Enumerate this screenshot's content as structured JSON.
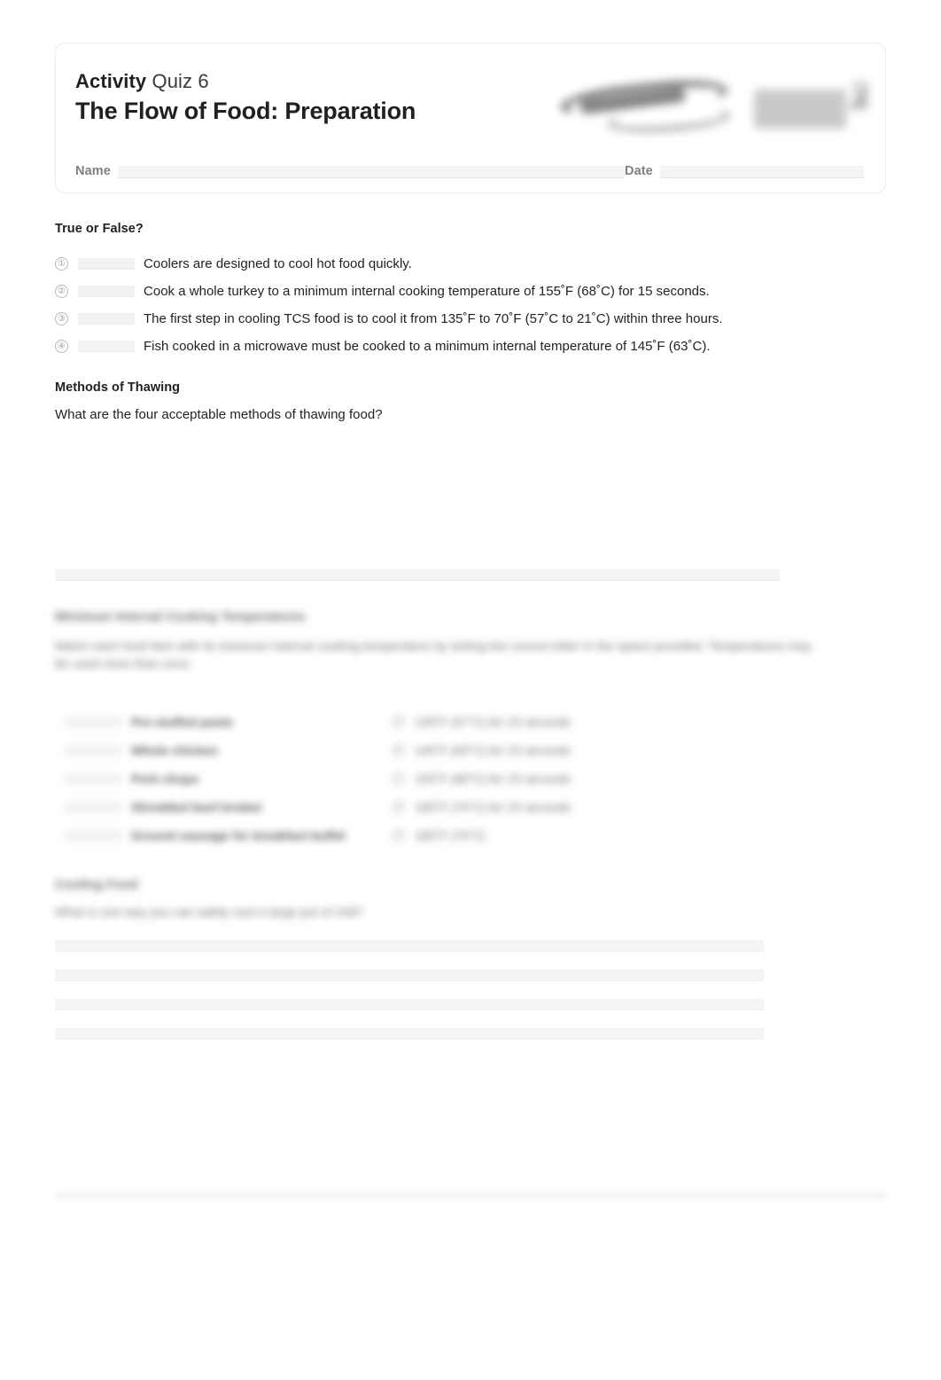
{
  "document": {
    "kicker_strong": "Activity",
    "kicker_light": "Quiz 6",
    "title": "The Flow of Food: Preparation",
    "name_label": "Name",
    "date_label": "Date",
    "name_value": "",
    "date_value": "",
    "logo": {
      "script_mark": "servsafe-script-logo",
      "secondary_mark": "national-restaurant-association-logo"
    }
  },
  "true_false": {
    "heading": "True or False?",
    "items": [
      {
        "number": "①",
        "answer": "",
        "text": "Coolers are designed to cool hot food quickly."
      },
      {
        "number": "②",
        "answer": "",
        "text": "Cook a whole turkey to a minimum internal cooking temperature of 155˚F (68˚C) for 15 seconds."
      },
      {
        "number": "③",
        "answer": "",
        "text": "The first step in cooling TCS food is to cool it from 135˚F to 70˚F (57˚C to 21˚C) within three hours."
      },
      {
        "number": "④",
        "answer": "",
        "text": "Fish cooked in a microwave must be cooked to a minimum internal temperature of 145˚F (63˚C)."
      }
    ]
  },
  "thawing": {
    "heading": "Methods of Thawing",
    "prompt": "What are the four acceptable methods of thawing food?",
    "answer_lines": 1
  },
  "temperatures": {
    "heading": "Minimum Internal Cooking Temperatures",
    "prompt": "Match each food item with its minimum internal cooking temperature by writing the correct letter in the space provided. Temperatures may be used more than once.",
    "left_items": [
      {
        "blank": "",
        "text": "Pre-stuffed pasta"
      },
      {
        "blank": "",
        "text": "Whole chicken"
      },
      {
        "blank": "",
        "text": "Pork chops"
      },
      {
        "blank": "",
        "text": "Shredded beef brisket"
      },
      {
        "blank": "",
        "text": "Ground sausage for breakfast buffet"
      }
    ],
    "right_items": [
      {
        "letter": "Ⓐ",
        "text": "135˚F (57˚C) for 15 seconds"
      },
      {
        "letter": "Ⓑ",
        "text": "145˚F (63˚C) for 15 seconds"
      },
      {
        "letter": "Ⓒ",
        "text": "155˚F (68˚C) for 15 seconds"
      },
      {
        "letter": "Ⓓ",
        "text": "165˚F (74˚C) for 15 seconds"
      },
      {
        "letter": "Ⓔ",
        "text": "165˚F (74˚C)"
      }
    ]
  },
  "cooling": {
    "heading": "Cooling Food",
    "prompt": "What is one way you can safely cool a large pot of chili?",
    "answer_lines": 4
  }
}
